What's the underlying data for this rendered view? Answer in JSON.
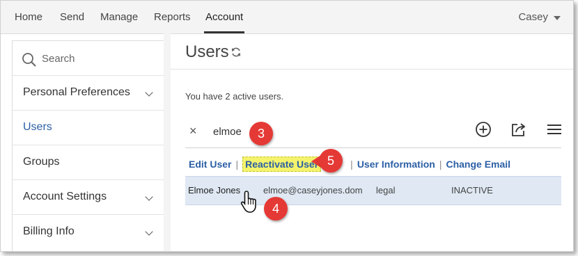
{
  "nav": {
    "tabs": [
      {
        "label": "Home"
      },
      {
        "label": "Send"
      },
      {
        "label": "Manage"
      },
      {
        "label": "Reports"
      },
      {
        "label": "Account",
        "active": true
      }
    ],
    "user_name": "Casey"
  },
  "sidebar": {
    "search_label": "Search",
    "items": [
      {
        "label": "Personal Preferences",
        "expandable": true
      },
      {
        "label": "Users",
        "active": true
      },
      {
        "label": "Groups"
      },
      {
        "label": "Account Settings",
        "expandable": true
      },
      {
        "label": "Billing Info",
        "expandable": true
      }
    ]
  },
  "main": {
    "title": "Users",
    "active_count_text": "You have 2 active users.",
    "search_term": "elmoe",
    "actions": {
      "edit_user": "Edit User",
      "reactivate_user": "Reactivate User",
      "user_information": "User Information",
      "change_email": "Change Email",
      "separator": "|"
    },
    "user_row": {
      "name": "Elmoe Jones",
      "email": "elmoe@caseyjones.dom",
      "group": "legal",
      "status": "INACTIVE"
    }
  },
  "callouts": {
    "step3": "3",
    "step4": "4",
    "step5": "5"
  },
  "colors": {
    "link_blue": "#2b5fa5",
    "highlight_yellow": "#f4f36b",
    "callout_red": "#e53935",
    "row_selected": "#dfe8f3"
  }
}
